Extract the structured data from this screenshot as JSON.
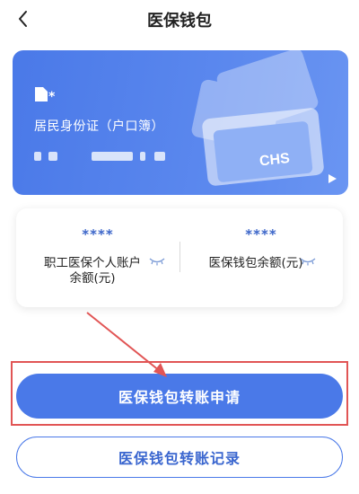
{
  "header": {
    "title": "医保钱包",
    "back_icon": "chevron-left-icon"
  },
  "card": {
    "name_masked": "*",
    "id_type": "居民身份证（户口簿）",
    "logo_text": "CHS",
    "colors": {
      "background": "#4a79e8"
    }
  },
  "balances": [
    {
      "value": "****",
      "label": "职工医保个人账户余额(元)",
      "eye_icon": "eye-closed-icon"
    },
    {
      "value": "****",
      "label": "医保钱包余额(元)",
      "eye_icon": "eye-closed-icon"
    }
  ],
  "buttons": {
    "transfer_apply": "医保钱包转账申请",
    "transfer_records": "医保钱包转账记录"
  },
  "colors": {
    "accent": "#4a79e8",
    "annotation": "#e15555"
  }
}
